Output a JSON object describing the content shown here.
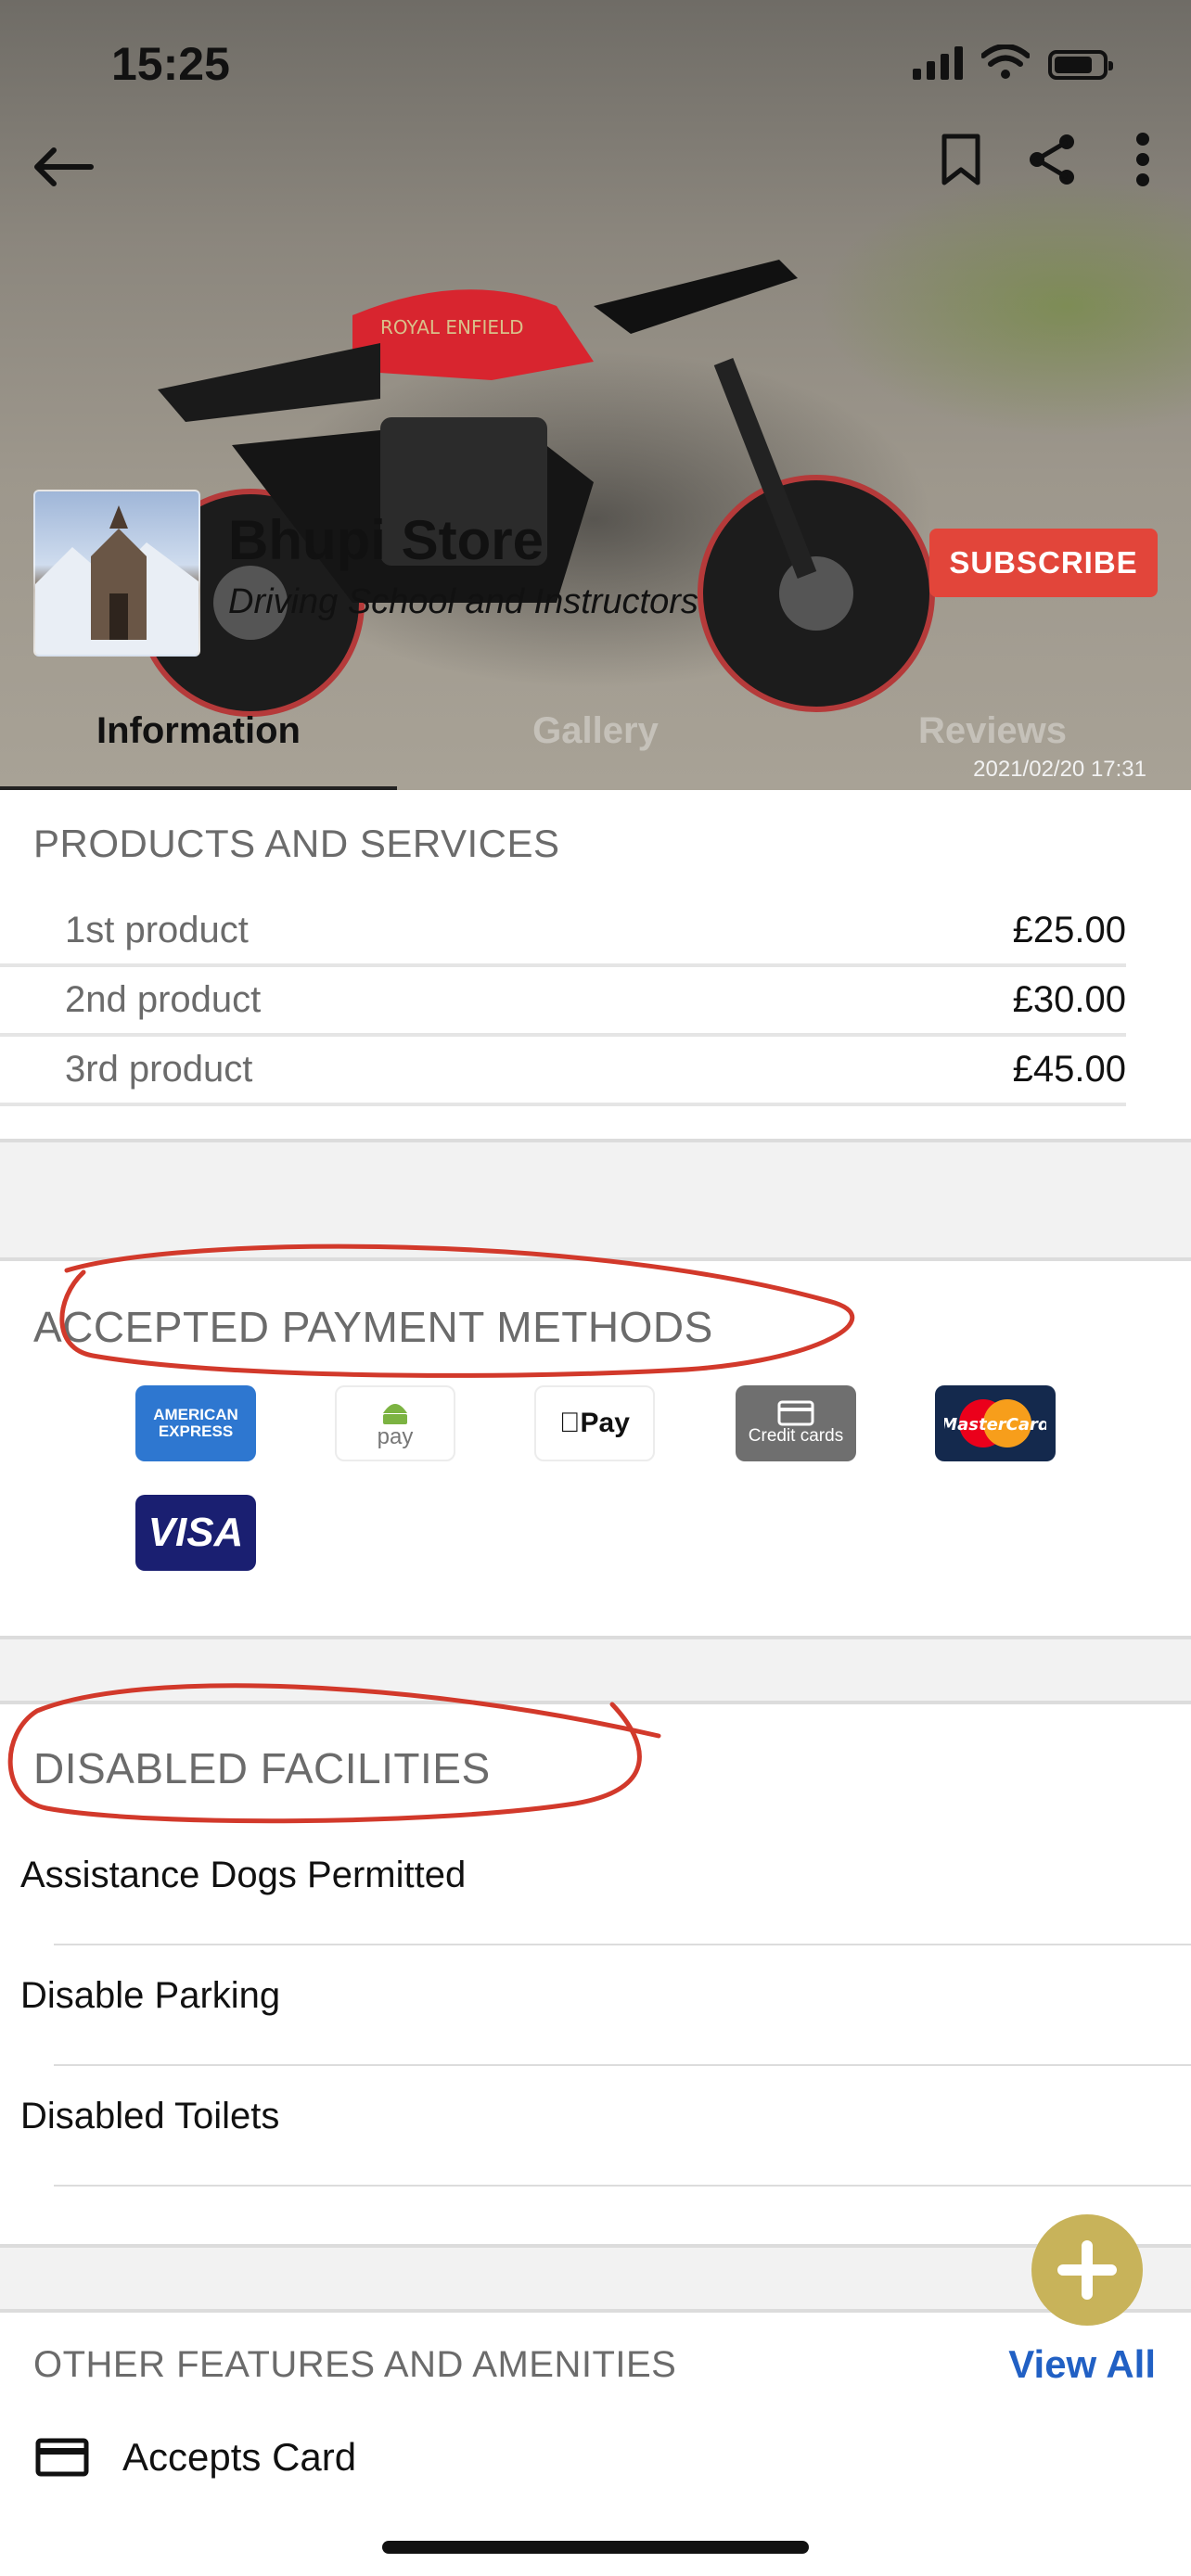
{
  "status_bar": {
    "time": "15:25"
  },
  "store": {
    "name": "Bhupi Store",
    "category": "Driving School and Instructors",
    "subscribe_label": "SUBSCRIBE",
    "photo_timestamp": "2021/02/20 17:31",
    "bike_badge": "ROYAL ENFIELD"
  },
  "tabs": [
    {
      "label": "Information",
      "active": true
    },
    {
      "label": "Gallery",
      "active": false
    },
    {
      "label": "Reviews",
      "active": false
    }
  ],
  "products": {
    "title": "PRODUCTS AND SERVICES",
    "items": [
      {
        "name": "1st product",
        "price": "£25.00"
      },
      {
        "name": "2nd product",
        "price": "£30.00"
      },
      {
        "name": "3rd product",
        "price": "£45.00"
      }
    ]
  },
  "payments": {
    "title": "ACCEPTED PAYMENT METHODS",
    "methods": [
      {
        "id": "amex",
        "line1": "AMERICAN",
        "line2": "EXPRESS"
      },
      {
        "id": "gpay",
        "label": "pay"
      },
      {
        "id": "applepay",
        "label": "Pay"
      },
      {
        "id": "creditcards",
        "label": "Credit cards"
      },
      {
        "id": "mastercard",
        "label": "MasterCard"
      },
      {
        "id": "visa",
        "label": "VISA"
      }
    ]
  },
  "facilities": {
    "title": "DISABLED FACILITIES",
    "items": [
      "Assistance Dogs Permitted",
      "Disable Parking",
      "Disabled Toilets"
    ]
  },
  "features": {
    "title": "OTHER FEATURES AND AMENITIES",
    "view_all": "View All",
    "items": [
      {
        "label": "Accepts Card",
        "icon": "credit-card-icon"
      }
    ]
  },
  "colors": {
    "subscribe": "#e2453a",
    "link": "#2160c4",
    "fab": "#c8b35a",
    "annotation": "#d2392b"
  }
}
